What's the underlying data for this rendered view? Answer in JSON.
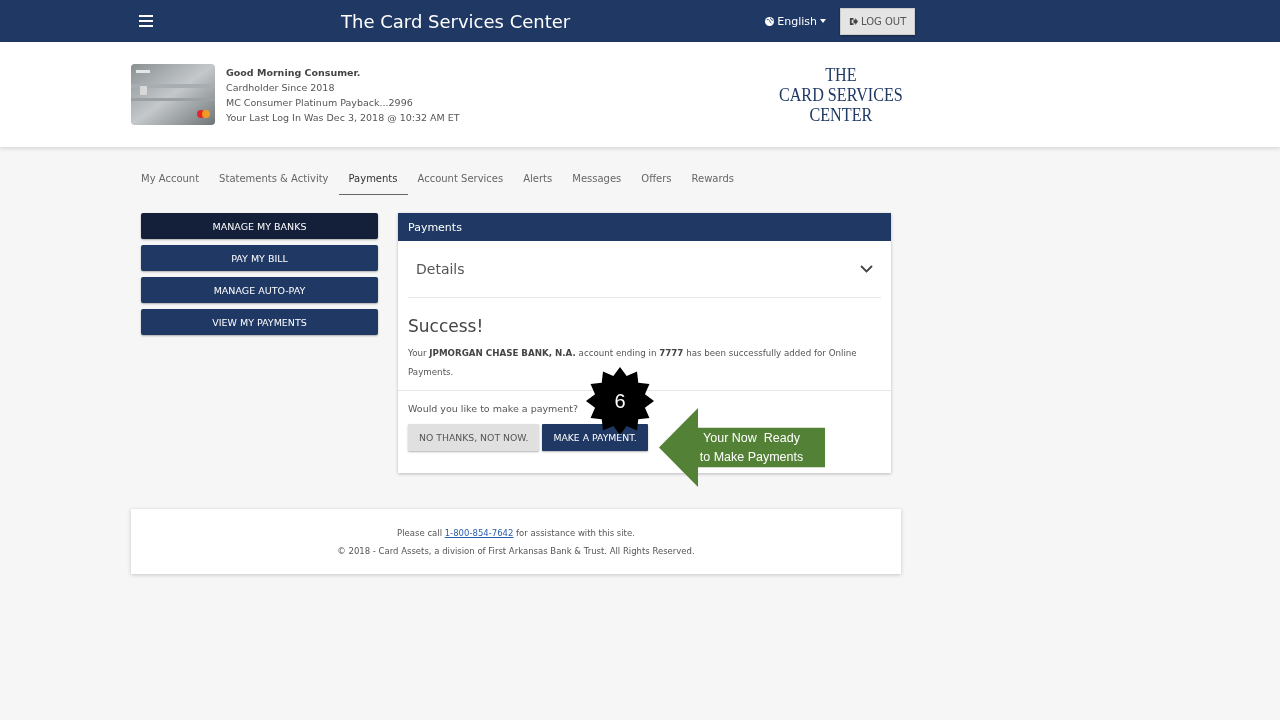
{
  "header": {
    "title": "The Card Services Center",
    "language": "English",
    "logout": "LOG OUT"
  },
  "banner": {
    "card": {
      "kind": "picture"
    },
    "greeting": "Good Morning Consumer.",
    "since": "Cardholder Since 2018",
    "product": "MC Consumer Platinum Payback...2996",
    "last_login": "Your Last Log In Was Dec 3, 2018 @ 10:32 AM ET",
    "logo": [
      "THE",
      "CARD SERVICES",
      "CENTER"
    ]
  },
  "tabs": [
    {
      "label": "My Account",
      "selected": false
    },
    {
      "label": "Statements & Activity",
      "selected": false
    },
    {
      "label": "Payments",
      "selected": true
    },
    {
      "label": "Account Services",
      "selected": false
    },
    {
      "label": "Alerts",
      "selected": false
    },
    {
      "label": "Messages",
      "selected": false
    },
    {
      "label": "Offers",
      "selected": false
    },
    {
      "label": "Rewards",
      "selected": false
    }
  ],
  "side_menu": [
    {
      "label": "MANAGE MY BANKS",
      "selected": true
    },
    {
      "label": "PAY MY BILL",
      "selected": false
    },
    {
      "label": "MANAGE AUTO-PAY",
      "selected": false
    },
    {
      "label": "VIEW MY PAYMENTS",
      "selected": false
    }
  ],
  "panel": {
    "title": "Payments",
    "details": {
      "label": "Details",
      "expanded": false
    },
    "success_title": "Success!",
    "message": "Your **JPMORGAN CHASE BANK, N.A.** account ending in **7777** has been successfully added for Online Payments.",
    "question": "Would you like to make a payment?",
    "buttons": [
      {
        "label": "NO THANKS, NOT NOW.",
        "kind": "secondary"
      },
      {
        "label": "MAKE A PAYMENT.",
        "kind": "primary"
      }
    ]
  },
  "footer": {
    "before": "Please call ",
    "phone": "1-800-854-7642",
    "after": " for assistance with this site.",
    "copyright": "© 2018 - Card Assets, a division of First Arkansas Bank & Trust. All Rights Reserved."
  },
  "callouts": {
    "step": "6",
    "arrow_text": "Your Now  Ready to Make Payments"
  }
}
